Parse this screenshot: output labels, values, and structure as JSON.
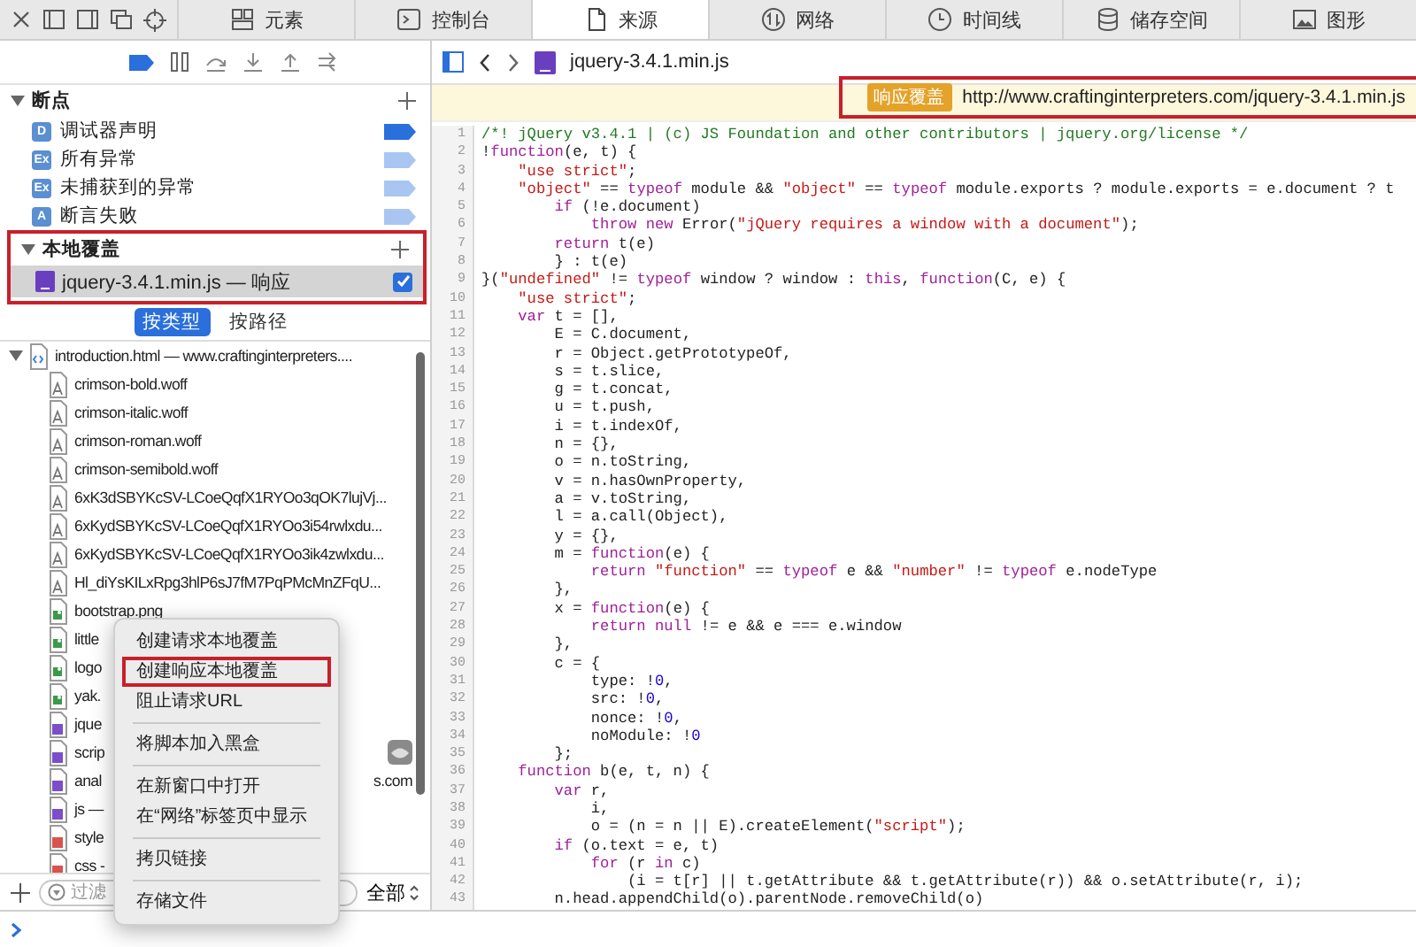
{
  "tabs": [
    {
      "kind": "elements",
      "label": "元素",
      "selected": false
    },
    {
      "kind": "console",
      "label": "控制台",
      "selected": false
    },
    {
      "kind": "sources",
      "label": "来源",
      "selected": true
    },
    {
      "kind": "network",
      "label": "网络",
      "selected": false
    },
    {
      "kind": "timeline",
      "label": "时间线",
      "selected": false
    },
    {
      "kind": "storage",
      "label": "储存空间",
      "selected": false
    },
    {
      "kind": "graphics",
      "label": "图形",
      "selected": false
    }
  ],
  "breakpoints": {
    "title": "断点",
    "expanded": true,
    "items": [
      {
        "badge": "D",
        "label": "调试器声明",
        "enabled": true
      },
      {
        "badge": "Ex",
        "label": "所有异常",
        "enabled": false
      },
      {
        "badge": "Ex",
        "label": "未捕获到的异常",
        "enabled": false
      },
      {
        "badge": "A",
        "label": "断言失败",
        "enabled": false
      }
    ]
  },
  "local_overrides": {
    "title": "本地覆盖",
    "expanded": true,
    "annotated": true,
    "items": [
      {
        "name": "jquery-3.4.1.min.js — 响应",
        "selected": true,
        "checked": true
      }
    ]
  },
  "group_by": [
    {
      "label": "按类型",
      "selected": true
    },
    {
      "label": "按路径",
      "selected": false
    }
  ],
  "resources": [
    {
      "name": "introduction.html — www.craftinginterpreters....",
      "kind": "html",
      "expanded": true,
      "children": [
        {
          "name": "crimson-bold.woff",
          "kind": "font"
        },
        {
          "name": "crimson-italic.woff",
          "kind": "font"
        },
        {
          "name": "crimson-roman.woff",
          "kind": "font"
        },
        {
          "name": "crimson-semibold.woff",
          "kind": "font"
        },
        {
          "name": "6xK3dSBYKcSV-LCoeQqfX1RYOo3qOK7lujVj...",
          "kind": "font"
        },
        {
          "name": "6xKydSBYKcSV-LCoeQqfX1RYOo3i54rwlxdu...",
          "kind": "font"
        },
        {
          "name": "6xKydSBYKcSV-LCoeQqfX1RYOo3ik4zwlxdu...",
          "kind": "font"
        },
        {
          "name": "Hl_diYsKILxRpg3hlP6sJ7fM7PqPMcMnZFqU...",
          "kind": "font"
        },
        {
          "name": "bootstrap.png",
          "kind": "image"
        },
        {
          "name": "little",
          "kind": "image"
        },
        {
          "name": "logo",
          "kind": "image"
        },
        {
          "name": "yak.",
          "kind": "image"
        },
        {
          "name": "jque",
          "kind": "script"
        },
        {
          "name": "scrip",
          "kind": "script",
          "blackboxed": true
        },
        {
          "name": "anal",
          "tail": "s.com",
          "kind": "script"
        },
        {
          "name": "js —",
          "kind": "script"
        },
        {
          "name": "style",
          "kind": "style"
        },
        {
          "name": "css -",
          "kind": "style"
        }
      ]
    }
  ],
  "filter": {
    "placeholder": "过滤",
    "scope": "全部"
  },
  "context_menu": {
    "groups": [
      {
        "items": [
          {
            "label": "创建请求本地覆盖",
            "annotated": false
          },
          {
            "label": "创建响应本地覆盖",
            "annotated": true
          },
          {
            "label": "阻止请求URL",
            "annotated": false
          }
        ]
      },
      {
        "items": [
          {
            "label": "将脚本加入黑盒",
            "annotated": false
          }
        ]
      },
      {
        "items": [
          {
            "label": "在新窗口中打开",
            "annotated": false
          },
          {
            "label": "在“网络”标签页中显示",
            "annotated": false
          }
        ]
      },
      {
        "items": [
          {
            "label": "拷贝链接",
            "annotated": false
          }
        ]
      },
      {
        "items": [
          {
            "label": "存储文件",
            "annotated": false
          }
        ]
      }
    ]
  },
  "editor": {
    "file": "jquery-3.4.1.min.js",
    "banner": {
      "badge": "响应覆盖",
      "url": "http://www.craftinginterpreters.com/jquery-3.4.1.min.js",
      "annotated": true
    },
    "lines": [
      {
        "number": "1",
        "tokens": [
          {
            "kind": "comment",
            "text": "/*! jQuery v3.4.1 | (c) JS Foundation and other contributors | jquery.org/license */"
          }
        ]
      },
      {
        "number": "2",
        "tokens": [
          {
            "kind": "plain",
            "text": "!"
          },
          {
            "kind": "keyword",
            "text": "function"
          },
          {
            "kind": "plain",
            "text": "(e, t) {"
          }
        ]
      },
      {
        "number": "3",
        "tokens": [
          {
            "kind": "string",
            "text": "    \"use strict\""
          },
          {
            "kind": "plain",
            "text": ";"
          }
        ]
      },
      {
        "number": "4",
        "tokens": [
          {
            "kind": "string",
            "text": "    \"object\""
          },
          {
            "kind": "plain",
            "text": " == "
          },
          {
            "kind": "keyword",
            "text": "typeof"
          },
          {
            "kind": "plain",
            "text": " module && "
          },
          {
            "kind": "string",
            "text": "\"object\""
          },
          {
            "kind": "plain",
            "text": " == "
          },
          {
            "kind": "keyword",
            "text": "typeof"
          },
          {
            "kind": "plain",
            "text": " module.exports ? module.exports = e.document ? t"
          }
        ]
      },
      {
        "number": "5",
        "tokens": [
          {
            "kind": "keyword",
            "text": "        if"
          },
          {
            "kind": "plain",
            "text": " (!e.document)"
          }
        ]
      },
      {
        "number": "6",
        "tokens": [
          {
            "kind": "keyword",
            "text": "            throw new"
          },
          {
            "kind": "plain",
            "text": " Error("
          },
          {
            "kind": "string",
            "text": "\"jQuery requires a window with a document\""
          },
          {
            "kind": "plain",
            "text": ");"
          }
        ]
      },
      {
        "number": "7",
        "tokens": [
          {
            "kind": "keyword",
            "text": "        return"
          },
          {
            "kind": "plain",
            "text": " t(e)"
          }
        ]
      },
      {
        "number": "8",
        "tokens": [
          {
            "kind": "plain",
            "text": "        } : t(e)"
          }
        ]
      },
      {
        "number": "9",
        "tokens": [
          {
            "kind": "plain",
            "text": "}("
          },
          {
            "kind": "string",
            "text": "\"undefined\""
          },
          {
            "kind": "plain",
            "text": " != "
          },
          {
            "kind": "keyword",
            "text": "typeof"
          },
          {
            "kind": "plain",
            "text": " window ? window : "
          },
          {
            "kind": "keyword",
            "text": "this"
          },
          {
            "kind": "plain",
            "text": ", "
          },
          {
            "kind": "keyword",
            "text": "function"
          },
          {
            "kind": "plain",
            "text": "(C, e) {"
          }
        ]
      },
      {
        "number": "10",
        "tokens": [
          {
            "kind": "string",
            "text": "    \"use strict\""
          },
          {
            "kind": "plain",
            "text": ";"
          }
        ]
      },
      {
        "number": "11",
        "tokens": [
          {
            "kind": "keyword",
            "text": "    var"
          },
          {
            "kind": "plain",
            "text": " t = [],"
          }
        ]
      },
      {
        "number": "12",
        "tokens": [
          {
            "kind": "plain",
            "text": "        E = C.document,"
          }
        ]
      },
      {
        "number": "13",
        "tokens": [
          {
            "kind": "plain",
            "text": "        r = Object.getPrototypeOf,"
          }
        ]
      },
      {
        "number": "14",
        "tokens": [
          {
            "kind": "plain",
            "text": "        s = t.slice,"
          }
        ]
      },
      {
        "number": "15",
        "tokens": [
          {
            "kind": "plain",
            "text": "        g = t.concat,"
          }
        ]
      },
      {
        "number": "16",
        "tokens": [
          {
            "kind": "plain",
            "text": "        u = t.push,"
          }
        ]
      },
      {
        "number": "17",
        "tokens": [
          {
            "kind": "plain",
            "text": "        i = t.indexOf,"
          }
        ]
      },
      {
        "number": "18",
        "tokens": [
          {
            "kind": "plain",
            "text": "        n = {},"
          }
        ]
      },
      {
        "number": "19",
        "tokens": [
          {
            "kind": "plain",
            "text": "        o = n.toString,"
          }
        ]
      },
      {
        "number": "20",
        "tokens": [
          {
            "kind": "plain",
            "text": "        v = n.hasOwnProperty,"
          }
        ]
      },
      {
        "number": "21",
        "tokens": [
          {
            "kind": "plain",
            "text": "        a = v.toString,"
          }
        ]
      },
      {
        "number": "22",
        "tokens": [
          {
            "kind": "plain",
            "text": "        l = a.call(Object),"
          }
        ]
      },
      {
        "number": "23",
        "tokens": [
          {
            "kind": "plain",
            "text": "        y = {},"
          }
        ]
      },
      {
        "number": "24",
        "tokens": [
          {
            "kind": "plain",
            "text": "        m = "
          },
          {
            "kind": "keyword",
            "text": "function"
          },
          {
            "kind": "plain",
            "text": "(e) {"
          }
        ]
      },
      {
        "number": "25",
        "tokens": [
          {
            "kind": "keyword",
            "text": "            return"
          },
          {
            "kind": "string",
            "text": " \"function\""
          },
          {
            "kind": "plain",
            "text": " == "
          },
          {
            "kind": "keyword",
            "text": "typeof"
          },
          {
            "kind": "plain",
            "text": " e && "
          },
          {
            "kind": "string",
            "text": "\"number\""
          },
          {
            "kind": "plain",
            "text": " != "
          },
          {
            "kind": "keyword",
            "text": "typeof"
          },
          {
            "kind": "plain",
            "text": " e.nodeType"
          }
        ]
      },
      {
        "number": "26",
        "tokens": [
          {
            "kind": "plain",
            "text": "        },"
          }
        ]
      },
      {
        "number": "27",
        "tokens": [
          {
            "kind": "plain",
            "text": "        x = "
          },
          {
            "kind": "keyword",
            "text": "function"
          },
          {
            "kind": "plain",
            "text": "(e) {"
          }
        ]
      },
      {
        "number": "28",
        "tokens": [
          {
            "kind": "keyword",
            "text": "            return null"
          },
          {
            "kind": "plain",
            "text": " != e && e === e.window"
          }
        ]
      },
      {
        "number": "29",
        "tokens": [
          {
            "kind": "plain",
            "text": "        },"
          }
        ]
      },
      {
        "number": "30",
        "tokens": [
          {
            "kind": "plain",
            "text": "        c = {"
          }
        ]
      },
      {
        "number": "31",
        "tokens": [
          {
            "kind": "plain",
            "text": "            type: !"
          },
          {
            "kind": "number",
            "text": "0"
          },
          {
            "kind": "plain",
            "text": ","
          }
        ]
      },
      {
        "number": "32",
        "tokens": [
          {
            "kind": "plain",
            "text": "            src: !"
          },
          {
            "kind": "number",
            "text": "0"
          },
          {
            "kind": "plain",
            "text": ","
          }
        ]
      },
      {
        "number": "33",
        "tokens": [
          {
            "kind": "plain",
            "text": "            nonce: !"
          },
          {
            "kind": "number",
            "text": "0"
          },
          {
            "kind": "plain",
            "text": ","
          }
        ]
      },
      {
        "number": "34",
        "tokens": [
          {
            "kind": "plain",
            "text": "            noModule: !"
          },
          {
            "kind": "number",
            "text": "0"
          }
        ]
      },
      {
        "number": "35",
        "tokens": [
          {
            "kind": "plain",
            "text": "        };"
          }
        ]
      },
      {
        "number": "36",
        "tokens": [
          {
            "kind": "keyword",
            "text": "    function"
          },
          {
            "kind": "plain",
            "text": " b(e, t, n) {"
          }
        ]
      },
      {
        "number": "37",
        "tokens": [
          {
            "kind": "keyword",
            "text": "        var"
          },
          {
            "kind": "plain",
            "text": " r,"
          }
        ]
      },
      {
        "number": "38",
        "tokens": [
          {
            "kind": "plain",
            "text": "            i,"
          }
        ]
      },
      {
        "number": "39",
        "tokens": [
          {
            "kind": "plain",
            "text": "            o = (n = n || E).createElement("
          },
          {
            "kind": "string",
            "text": "\"script\""
          },
          {
            "kind": "plain",
            "text": ");"
          }
        ]
      },
      {
        "number": "40",
        "tokens": [
          {
            "kind": "keyword",
            "text": "        if"
          },
          {
            "kind": "plain",
            "text": " (o.text = e, t)"
          }
        ]
      },
      {
        "number": "41",
        "tokens": [
          {
            "kind": "keyword",
            "text": "            for"
          },
          {
            "kind": "plain",
            "text": " (r "
          },
          {
            "kind": "keyword",
            "text": "in"
          },
          {
            "kind": "plain",
            "text": " c)"
          }
        ]
      },
      {
        "number": "42",
        "tokens": [
          {
            "kind": "plain",
            "text": "                (i = t[r] || t.getAttribute && t.getAttribute(r)) && o.setAttribute(r, i);"
          }
        ]
      },
      {
        "number": "43",
        "tokens": [
          {
            "kind": "plain",
            "text": "        n.head.appendChild(o).parentNode.removeChild(o)"
          }
        ]
      }
    ]
  }
}
